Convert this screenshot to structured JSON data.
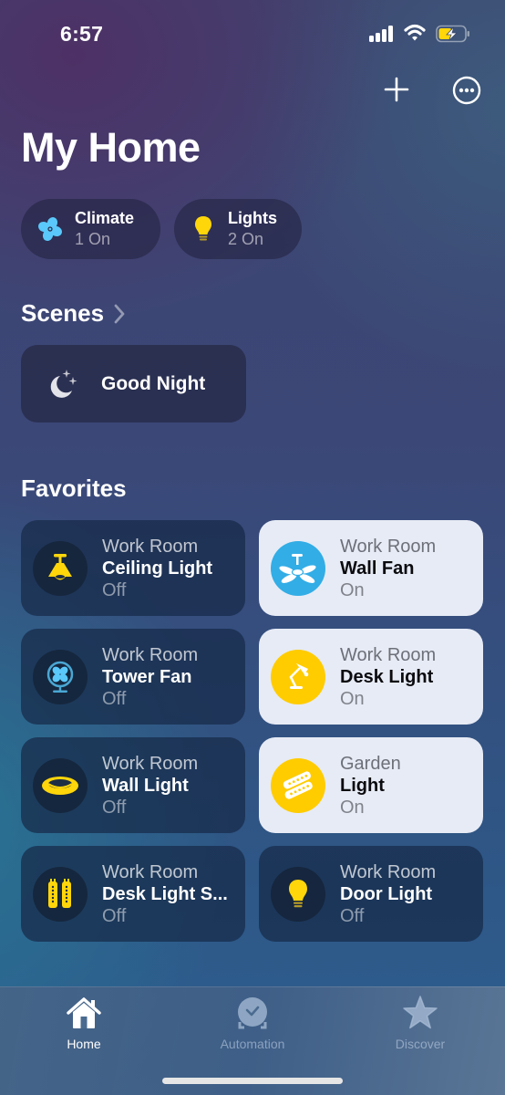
{
  "status_bar": {
    "time": "6:57",
    "icons": [
      "cellular-signal-icon",
      "wifi-icon",
      "battery-charging-icon"
    ]
  },
  "top_actions": {
    "add_icon": "plus-icon",
    "more_icon": "ellipsis-circle-icon"
  },
  "header": {
    "title": "My Home"
  },
  "summary": [
    {
      "icon": "fan-icon",
      "title": "Climate",
      "subtitle": "1 On",
      "color": "#5ac8fa"
    },
    {
      "icon": "lightbulb-icon",
      "title": "Lights",
      "subtitle": "2 On",
      "color": "#ffd60a"
    }
  ],
  "scenes": {
    "title": "Scenes",
    "items": [
      {
        "icon": "moon-stars-icon",
        "label": "Good Night"
      }
    ]
  },
  "favorites": {
    "title": "Favorites",
    "items": [
      {
        "room": "Work Room",
        "name": "Ceiling Light",
        "state": "Off",
        "on": false,
        "icon": "ceiling-light-icon",
        "icon_color": "#ffd60a"
      },
      {
        "room": "Work Room",
        "name": "Wall Fan",
        "state": "On",
        "on": true,
        "icon": "ceiling-fan-icon",
        "icon_color": "#32ade6"
      },
      {
        "room": "Work Room",
        "name": "Tower Fan",
        "state": "Off",
        "on": false,
        "icon": "desk-fan-icon",
        "icon_color": "#5ac8fa"
      },
      {
        "room": "Work Room",
        "name": "Desk Light",
        "state": "On",
        "on": true,
        "icon": "desk-lamp-icon",
        "icon_color": "#ffcc00"
      },
      {
        "room": "Work Room",
        "name": "Wall Light",
        "state": "Off",
        "on": false,
        "icon": "wall-light-icon",
        "icon_color": "#ffd60a"
      },
      {
        "room": "Garden",
        "name": "Light",
        "state": "On",
        "on": true,
        "icon": "light-strip-icon",
        "icon_color": "#ffcc00"
      },
      {
        "room": "Work Room",
        "name": "Desk Light S...",
        "state": "Off",
        "on": false,
        "icon": "light-strip-vertical-icon",
        "icon_color": "#ffd60a"
      },
      {
        "room": "Work Room",
        "name": "Door Light",
        "state": "Off",
        "on": false,
        "icon": "lightbulb-icon",
        "icon_color": "#ffd60a"
      }
    ]
  },
  "tab_bar": {
    "tabs": [
      {
        "label": "Home",
        "icon": "house-icon",
        "active": true
      },
      {
        "label": "Automation",
        "icon": "clock-check-icon",
        "active": false
      },
      {
        "label": "Discover",
        "icon": "star-icon",
        "active": false
      }
    ]
  }
}
